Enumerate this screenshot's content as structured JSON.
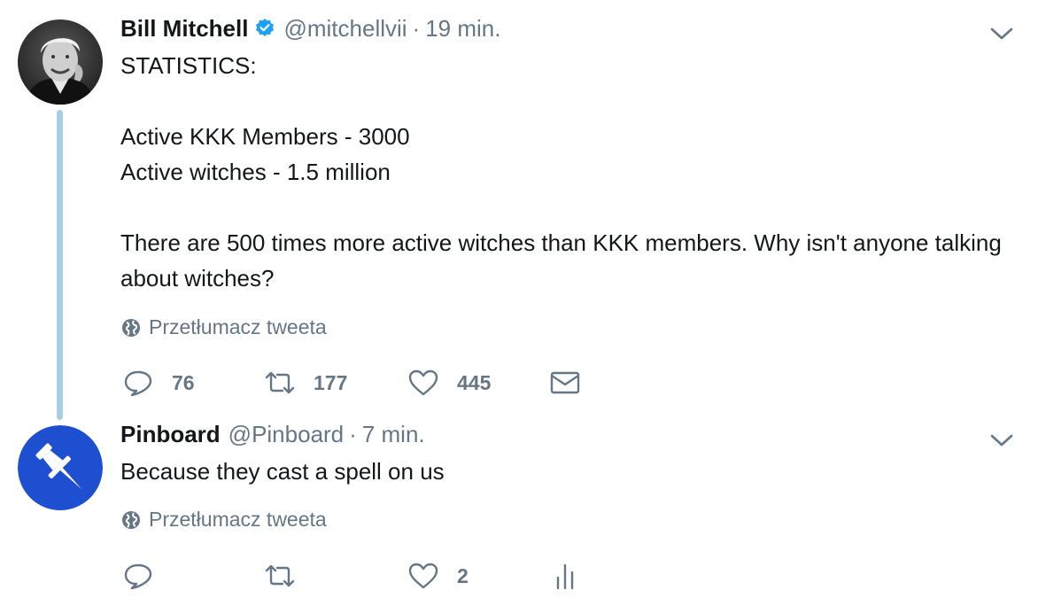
{
  "tweets": [
    {
      "author": "Bill Mitchell",
      "verified": true,
      "handle": "@mitchellvii",
      "separator": "·",
      "time": "19 min.",
      "text_lines": [
        "STATISTICS:",
        "",
        "Active KKK Members - 3000",
        "Active witches - 1.5 million",
        "",
        "There are 500 times more active witches than KKK members.  Why isn't anyone talking about witches?"
      ],
      "translate_label": "Przetłumacz tweeta",
      "actions": {
        "reply_count": "76",
        "retweet_count": "177",
        "like_count": "445",
        "extra_icon": "envelope-icon"
      }
    },
    {
      "author": "Pinboard",
      "verified": false,
      "handle": "@Pinboard",
      "separator": "·",
      "time": "7 min.",
      "text_lines": [
        "Because they cast a spell on us"
      ],
      "translate_label": "Przetłumacz tweeta",
      "actions": {
        "reply_count": "",
        "retweet_count": "",
        "like_count": "2",
        "extra_icon": "analytics-icon"
      }
    }
  ],
  "colors": {
    "text": "#14171a",
    "secondary": "#657786",
    "verified": "#1da1f2",
    "thread_line": "#a6cfe3",
    "pinboard_avatar": "#1f4fd1"
  }
}
